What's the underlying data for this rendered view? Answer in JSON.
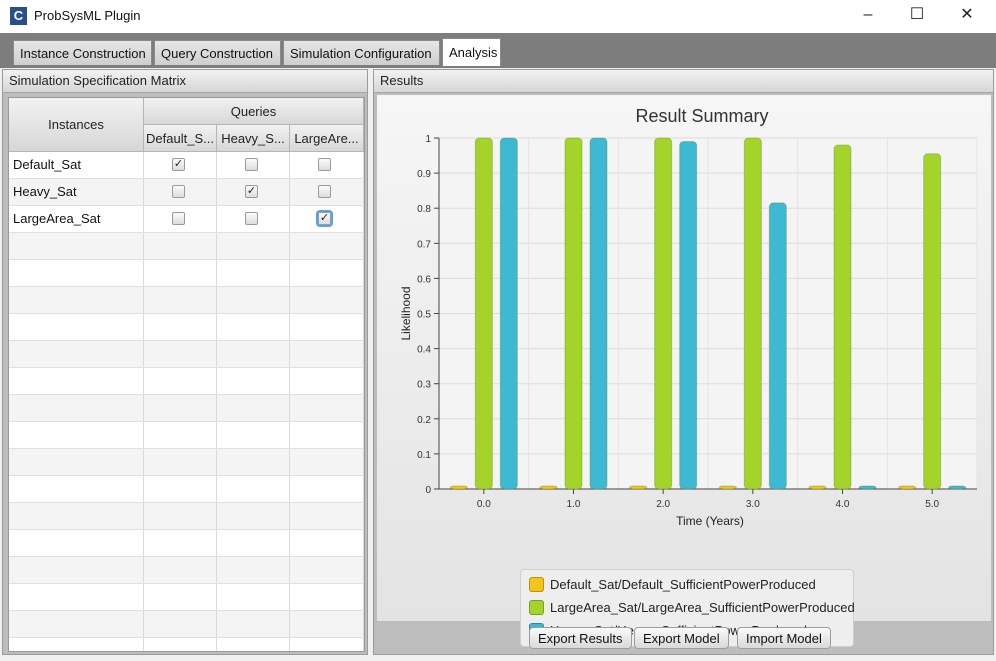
{
  "window": {
    "icon_letter": "C",
    "title": "ProbSysML Plugin",
    "minimize": "–",
    "maximize": "☐",
    "close": "✕"
  },
  "tabs": [
    {
      "label": "Instance Construction"
    },
    {
      "label": "Query Construction"
    },
    {
      "label": "Simulation Configuration"
    },
    {
      "label": "Analysis"
    }
  ],
  "left_panel": {
    "title": "Simulation Specification Matrix",
    "instances_header": "Instances",
    "queries_header": "Queries",
    "query_columns": [
      "Default_S...",
      "Heavy_S...",
      "LargeAre..."
    ],
    "rows": [
      {
        "instance": "Default_Sat",
        "checks": [
          true,
          false,
          false
        ]
      },
      {
        "instance": "Heavy_Sat",
        "checks": [
          false,
          true,
          false
        ]
      },
      {
        "instance": "LargeArea_Sat",
        "checks": [
          false,
          false,
          true
        ]
      }
    ],
    "check_glyph": "✓"
  },
  "right_panel": {
    "title": "Results",
    "buttons": {
      "export_results": "Export Results",
      "export_model": "Export Model",
      "import_model": "Import Model"
    }
  },
  "chart_data": {
    "type": "bar",
    "title": "Result Summary",
    "xlabel": "Time (Years)",
    "ylabel": "Likelihood",
    "categories": [
      "0.0",
      "1.0",
      "2.0",
      "3.0",
      "4.0",
      "5.0"
    ],
    "ylim": [
      0,
      1
    ],
    "yticks": [
      "0",
      "0.1",
      "0.2",
      "0.3",
      "0.4",
      "0.5",
      "0.6",
      "0.7",
      "0.8",
      "0.9",
      "1"
    ],
    "grid": true,
    "legend_position": "bottom",
    "series": [
      {
        "name": "Default_Sat/Default_SufficientPowerProduced",
        "color": "#f3c419",
        "values": [
          0,
          0,
          0,
          0,
          0,
          0
        ]
      },
      {
        "name": "LargeArea_Sat/LargeArea_SufficientPowerProduced",
        "color": "#a4d42a",
        "values": [
          1.0,
          1.0,
          1.0,
          1.0,
          0.98,
          0.955
        ]
      },
      {
        "name": "Heavy_Sat/Heavy_SufficientPowerProduced",
        "color": "#3eb9d3",
        "values": [
          1.0,
          1.0,
          0.99,
          0.815,
          0,
          0
        ]
      }
    ]
  }
}
